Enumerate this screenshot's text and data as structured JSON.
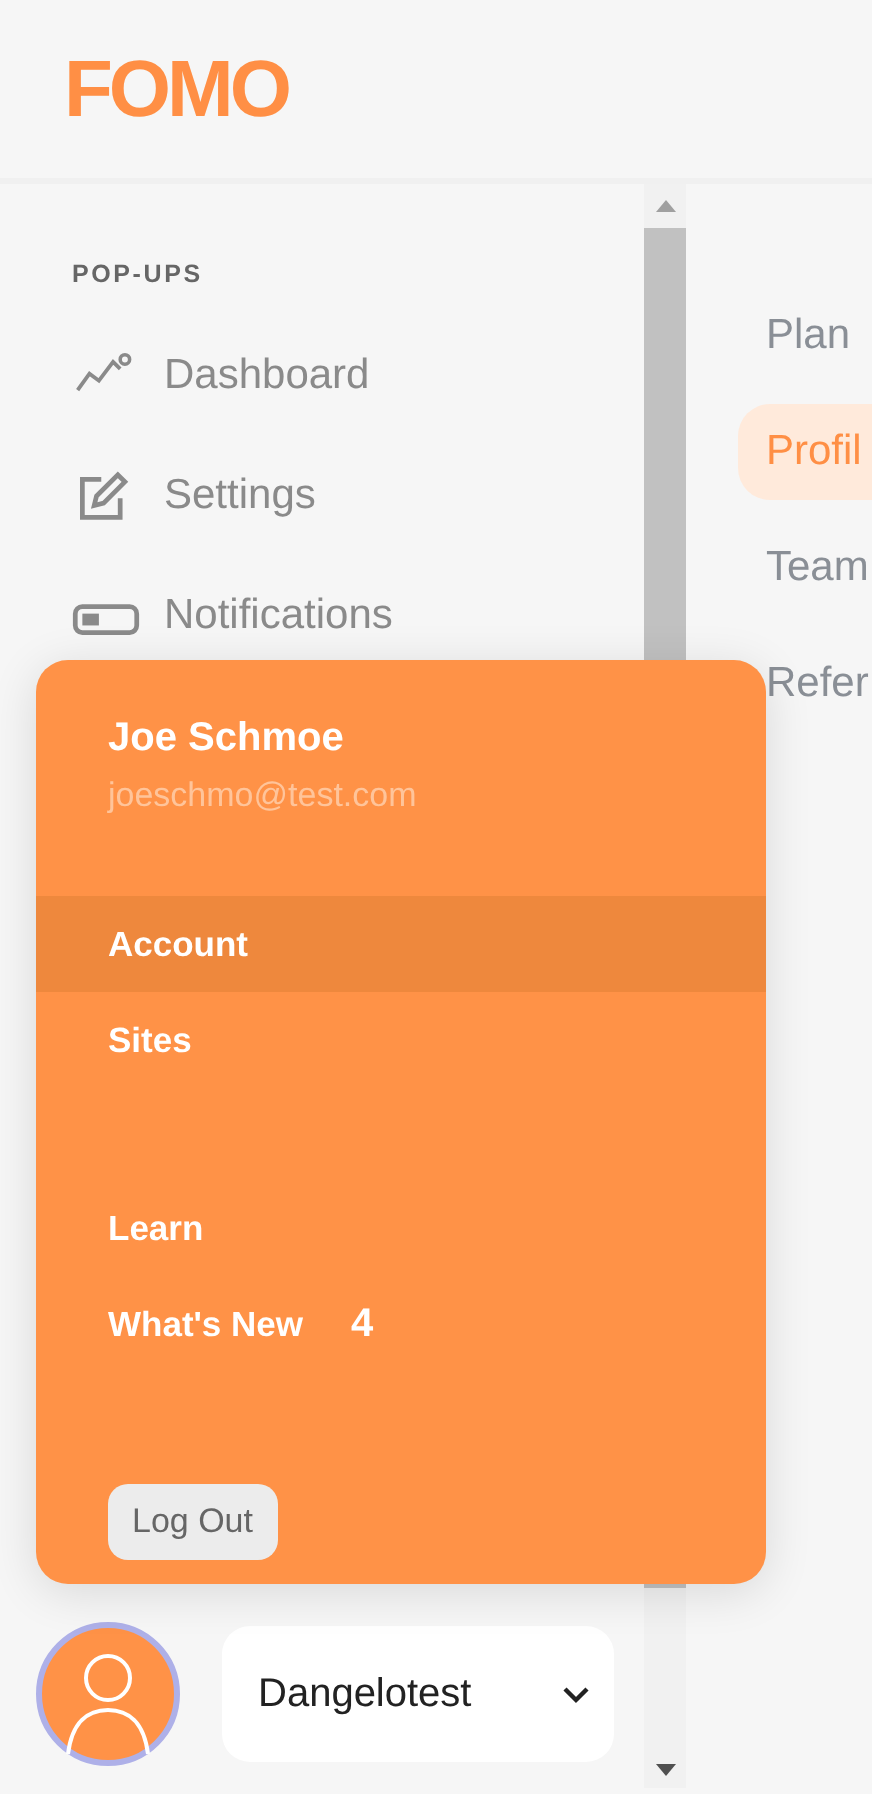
{
  "logo": "FOMO",
  "sidebar": {
    "section": "POP-UPS",
    "items": [
      {
        "label": "Dashboard"
      },
      {
        "label": "Settings"
      },
      {
        "label": "Notifications"
      }
    ]
  },
  "tabs": [
    {
      "label": "Plan",
      "selected": false
    },
    {
      "label": "Profil",
      "selected": true
    },
    {
      "label": "Team",
      "selected": false
    },
    {
      "label": "Refer",
      "selected": false
    }
  ],
  "account_menu": {
    "name": "Joe Schmoe",
    "email": "joeschmo@test.com",
    "groups": [
      [
        {
          "label": "Account",
          "selected": true
        },
        {
          "label": "Sites",
          "selected": false
        }
      ],
      [
        {
          "label": "Learn",
          "selected": false
        },
        {
          "label": "What's New",
          "selected": false,
          "badge": "4"
        }
      ]
    ],
    "logout": "Log Out"
  },
  "site_select": {
    "value": "Dangelotest"
  }
}
